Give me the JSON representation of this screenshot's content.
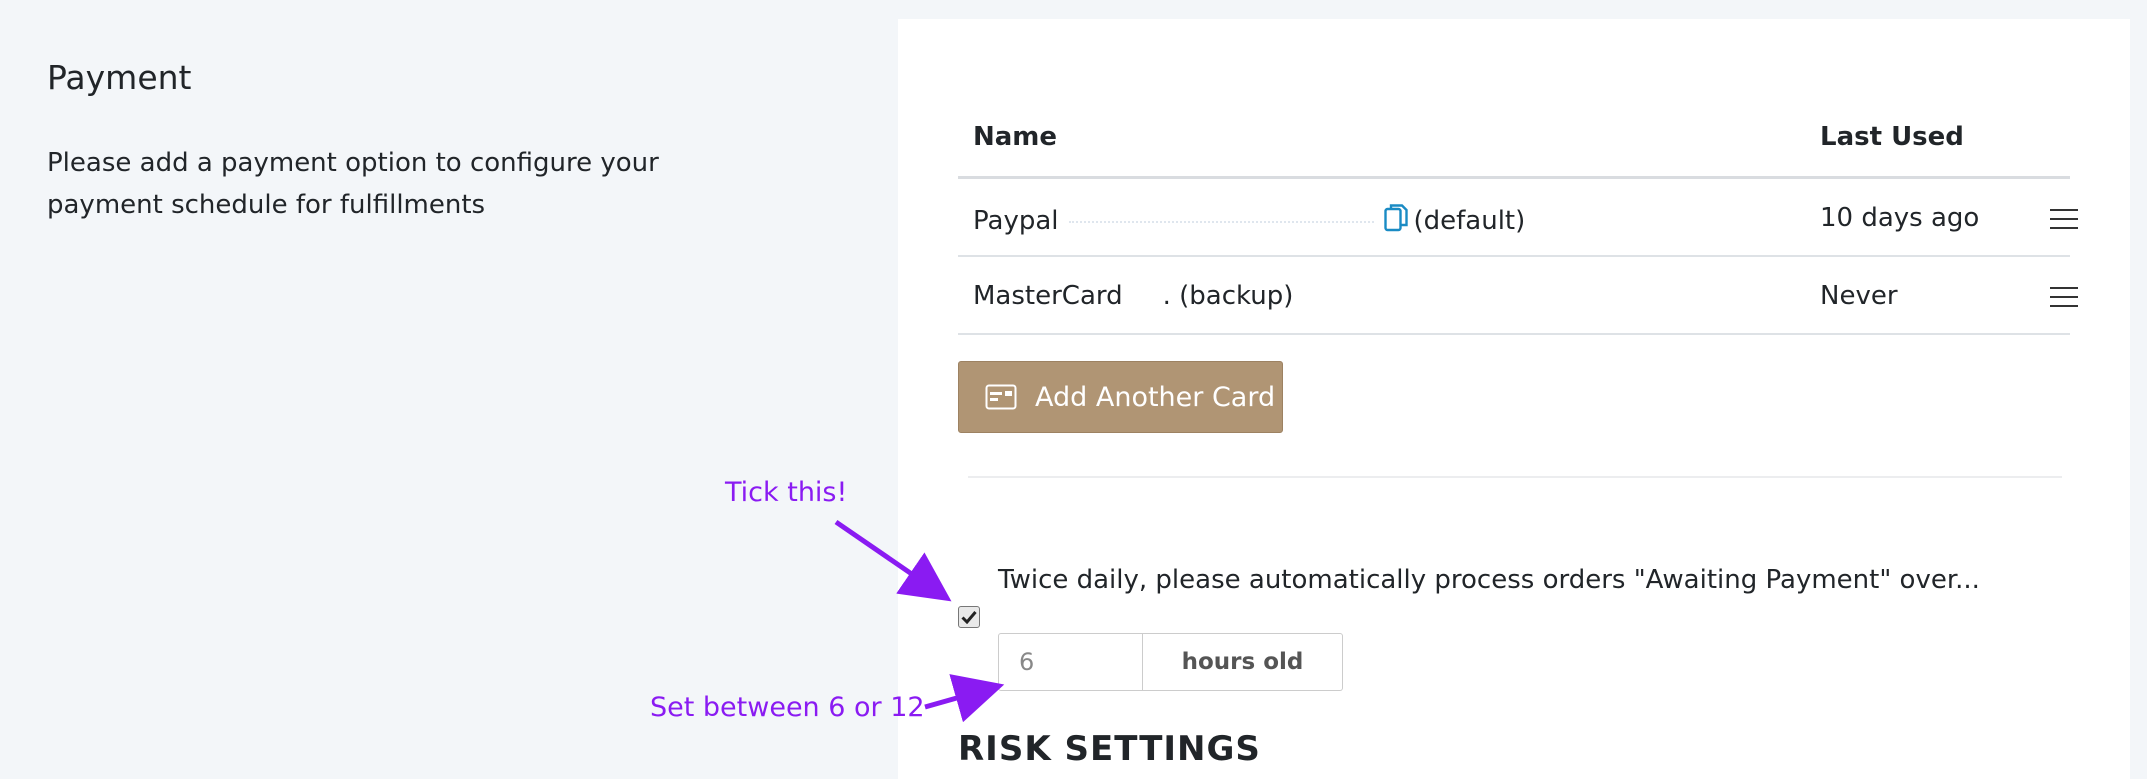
{
  "left": {
    "title": "Payment",
    "description": "Please add a payment option to configure your payment schedule for fulfillments"
  },
  "table": {
    "headers": {
      "name": "Name",
      "last_used": "Last Used"
    },
    "rows": [
      {
        "method": "Paypal",
        "tag": "(default)",
        "last_used": "10 days ago",
        "has_copy_icon": true
      },
      {
        "method": "MasterCard",
        "tag": ". (backup)",
        "last_used": "Never",
        "has_copy_icon": false
      }
    ]
  },
  "add_card": {
    "label": "Add Another Card",
    "icon": "credit-card-icon"
  },
  "auto_process": {
    "checked": true,
    "label": "Twice daily, please automatically process orders \"Awaiting Payment\" over...",
    "hours_value": "6",
    "hours_suffix": "hours old"
  },
  "risk_section": {
    "title": "RISK SETTINGS"
  },
  "annotations": {
    "tick": "Tick this!",
    "set_between": "Set between 6 or 12"
  },
  "colors": {
    "accent_button": "#b09574",
    "annotation": "#8a1bf2",
    "copy_icon": "#1a8bc4",
    "background": "#f3f6f9"
  }
}
